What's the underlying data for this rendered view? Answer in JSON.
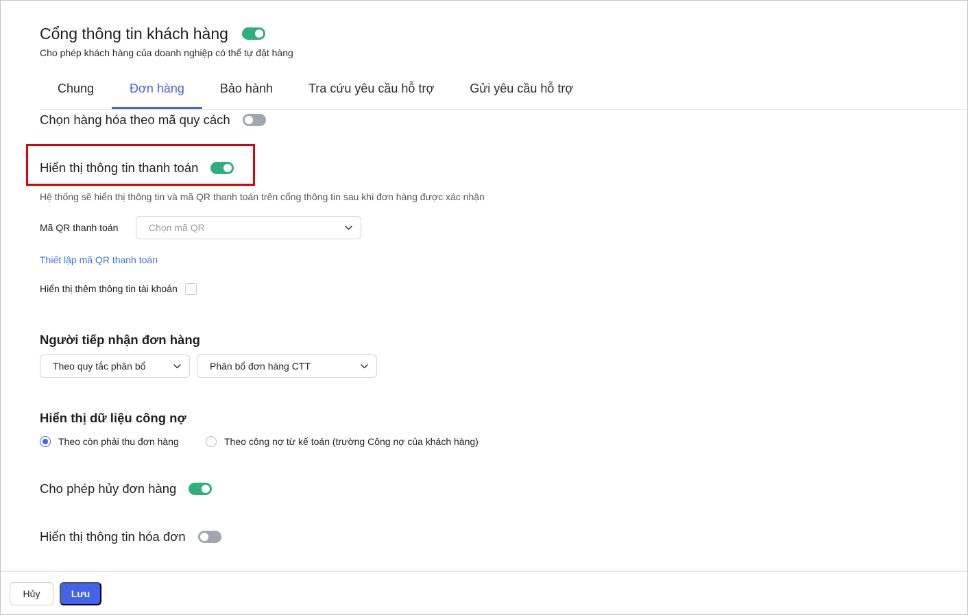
{
  "header": {
    "title": "Cổng thông tin khách hàng",
    "enabled": true,
    "subtitle": "Cho phép khách hàng của doanh nghiệp có thể tự đặt hàng"
  },
  "tabs": [
    {
      "label": "Chung",
      "active": false
    },
    {
      "label": "Đơn hàng",
      "active": true
    },
    {
      "label": "Bảo hành",
      "active": false
    },
    {
      "label": "Tra cứu yêu cầu hỗ trợ",
      "active": false
    },
    {
      "label": "Gửi yêu cầu hỗ trợ",
      "active": false
    }
  ],
  "settings": {
    "select_by_spec_code": {
      "label": "Chọn hàng hóa theo mã quy cách",
      "enabled": false
    },
    "show_payment_info": {
      "label": "Hiển thị thông tin thanh toán",
      "enabled": true,
      "description": "Hệ thống sẽ hiển thị thông tin và mã QR thanh toán trên cổng thông tin sau khi đơn hàng được xác nhận",
      "qr_label": "Mã QR thanh toán",
      "qr_placeholder": "Chọn mã QR",
      "qr_setup_link": "Thiết lập mã QR thanh toán",
      "show_account_info_label": "Hiển thị thêm thông tin tài khoản",
      "show_account_info_checked": false
    },
    "order_receiver": {
      "heading": "Người tiếp nhận đơn hàng",
      "mode_value": "Theo quy tắc phân bổ",
      "rule_value": "Phân bổ đơn hàng CTT"
    },
    "debt_display": {
      "heading": "Hiển thị dữ liệu công nợ",
      "options": [
        {
          "label": "Theo còn phải thu đơn hàng",
          "selected": true
        },
        {
          "label": "Theo công nợ từ kế toán (trường Công nợ của khách hàng)",
          "selected": false
        }
      ]
    },
    "allow_cancel": {
      "label": "Cho phép hủy đơn hàng",
      "enabled": true
    },
    "show_invoice_info": {
      "label": "Hiển thị thông tin hóa đơn",
      "enabled": false
    }
  },
  "footer": {
    "cancel_label": "Hủy",
    "save_label": "Lưu"
  },
  "theme": {
    "accent": "#4263eb",
    "toggle_on": "#2faf80",
    "toggle_off": "#a2a7af",
    "link": "#3a6fe3",
    "highlight": "#e50000"
  },
  "icons": {
    "dropdown": "chevron-down-icon"
  }
}
